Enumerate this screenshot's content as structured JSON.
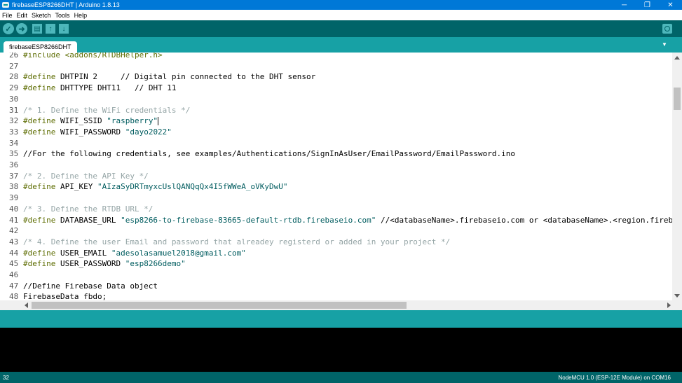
{
  "window": {
    "title": "firebaseESP8266DHT | Arduino 1.8.13",
    "controls": [
      "─",
      "❐",
      "✕"
    ]
  },
  "menu": [
    "File",
    "Edit",
    "Sketch",
    "Tools",
    "Help"
  ],
  "toolbar": {
    "buttons": [
      "verify-icon",
      "upload-icon",
      "new-icon",
      "open-icon",
      "save-icon",
      "serial-monitor-icon"
    ]
  },
  "tabs": [
    {
      "label": "firebaseESP8266DHT"
    }
  ],
  "editor": {
    "lines": [
      {
        "num": "26",
        "code": [
          {
            "t": "#include <addons/RTDBHelper.h>",
            "c": "kw"
          }
        ]
      },
      {
        "num": "27",
        "code": []
      },
      {
        "num": "28",
        "code": [
          {
            "t": "#define",
            "c": "kw"
          },
          {
            "t": " DHTPIN 2     ",
            "c": ""
          },
          {
            "t": "// Digital pin connected to the DHT sensor",
            "c": ""
          }
        ]
      },
      {
        "num": "29",
        "code": [
          {
            "t": "#define",
            "c": "kw"
          },
          {
            "t": " DHTTYPE DHT11   ",
            "c": ""
          },
          {
            "t": "// DHT 11",
            "c": ""
          }
        ]
      },
      {
        "num": "30",
        "code": []
      },
      {
        "num": "31",
        "code": [
          {
            "t": "/* 1. Define the WiFi credentials */",
            "c": "cm"
          }
        ]
      },
      {
        "num": "32",
        "code": [
          {
            "t": "#define",
            "c": "kw"
          },
          {
            "t": " WIFI_SSID ",
            "c": ""
          },
          {
            "t": "\"raspberry\"",
            "c": "str"
          }
        ],
        "caret": true
      },
      {
        "num": "33",
        "code": [
          {
            "t": "#define",
            "c": "kw"
          },
          {
            "t": " WIFI_PASSWORD ",
            "c": ""
          },
          {
            "t": "\"dayo2022\"",
            "c": "str"
          }
        ]
      },
      {
        "num": "34",
        "code": []
      },
      {
        "num": "35",
        "code": [
          {
            "t": "//For the following credentials, see examples/Authentications/SignInAsUser/EmailPassword/EmailPassword.ino",
            "c": ""
          }
        ]
      },
      {
        "num": "36",
        "code": []
      },
      {
        "num": "37",
        "code": [
          {
            "t": "/* 2. Define the API Key */",
            "c": "cm"
          }
        ]
      },
      {
        "num": "38",
        "code": [
          {
            "t": "#define",
            "c": "kw"
          },
          {
            "t": " API_KEY ",
            "c": ""
          },
          {
            "t": "\"AIzaSyDRTmyxcUslQANQqQx4I5fWWeA_oVKyDwU\"",
            "c": "str"
          }
        ]
      },
      {
        "num": "39",
        "code": []
      },
      {
        "num": "40",
        "code": [
          {
            "t": "/* 3. Define the RTDB URL */",
            "c": "cm"
          }
        ]
      },
      {
        "num": "41",
        "code": [
          {
            "t": "#define",
            "c": "kw"
          },
          {
            "t": " DATABASE_URL ",
            "c": ""
          },
          {
            "t": "\"esp8266-to-firebase-83665-default-rtdb.firebaseio.com\"",
            "c": "str"
          },
          {
            "t": " //<databaseName>.firebaseio.com or <databaseName>.<region.firebasedatabase.app",
            "c": ""
          }
        ]
      },
      {
        "num": "42",
        "code": []
      },
      {
        "num": "43",
        "code": [
          {
            "t": "/* 4. Define the user Email and password that alreadey registerd or added in your project */",
            "c": "cm"
          }
        ]
      },
      {
        "num": "44",
        "code": [
          {
            "t": "#define",
            "c": "kw"
          },
          {
            "t": " USER_EMAIL ",
            "c": ""
          },
          {
            "t": "\"adesolasamuel2018@gmail.com\"",
            "c": "str"
          }
        ]
      },
      {
        "num": "45",
        "code": [
          {
            "t": "#define",
            "c": "kw"
          },
          {
            "t": " USER_PASSWORD ",
            "c": ""
          },
          {
            "t": "\"esp8266demo\"",
            "c": "str"
          }
        ]
      },
      {
        "num": "46",
        "code": []
      },
      {
        "num": "47",
        "code": [
          {
            "t": "//Define Firebase Data object",
            "c": ""
          }
        ]
      },
      {
        "num": "48",
        "code": [
          {
            "t": "FirebaseData fbdo;",
            "c": ""
          }
        ]
      }
    ]
  },
  "footer": {
    "line_number": "32",
    "board": "NodeMCU 1.0 (ESP-12E Module) on COM16"
  },
  "colors": {
    "toolbar": "#006468",
    "tabsbar": "#17a1a5",
    "keyword": "#5e6d03",
    "comment": "#95a5a6",
    "string": "#005c5f"
  }
}
